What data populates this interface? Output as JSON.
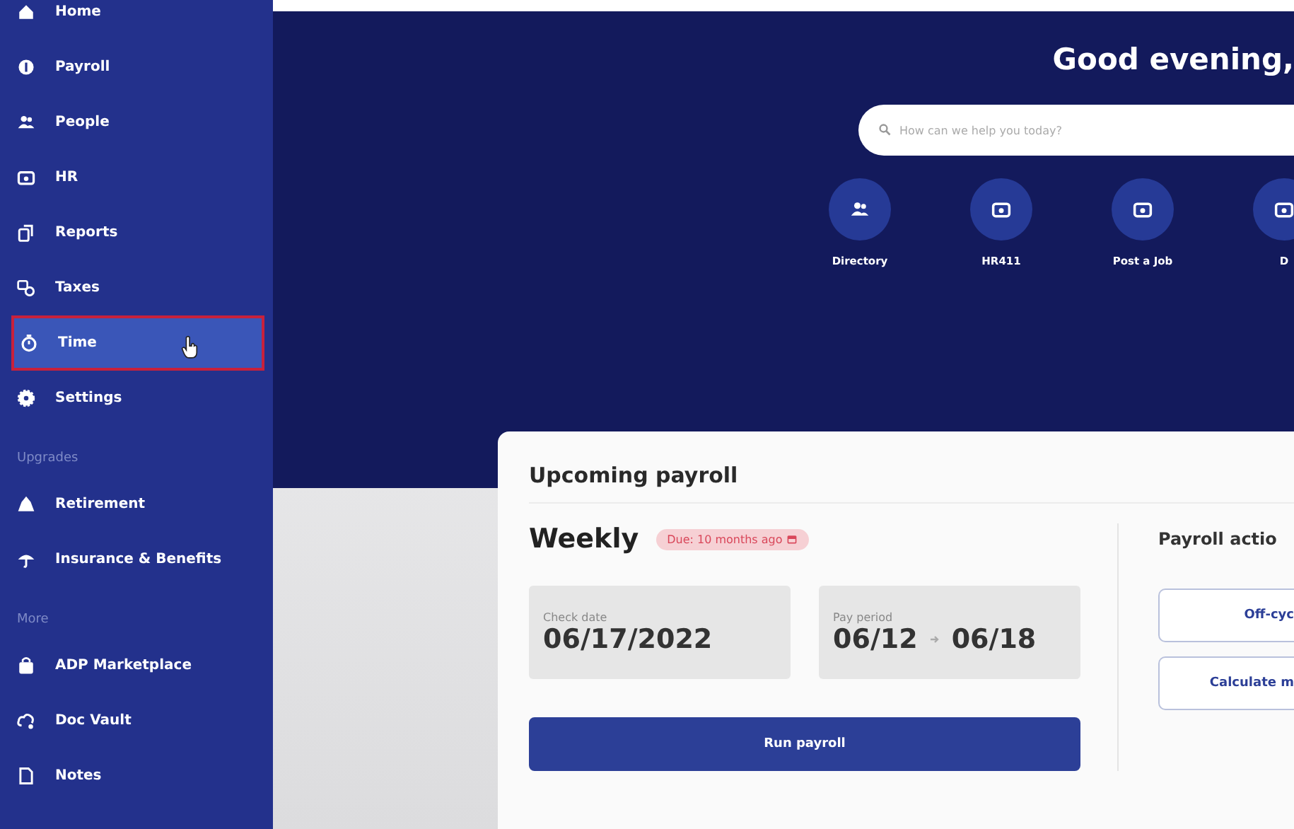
{
  "sidebar": {
    "sections": [
      {
        "items": [
          {
            "label": "Home",
            "selected": false
          },
          {
            "label": "Payroll",
            "selected": false
          },
          {
            "label": "People",
            "selected": false
          },
          {
            "label": "HR",
            "selected": false
          },
          {
            "label": "Reports",
            "selected": false
          },
          {
            "label": "Taxes",
            "selected": false
          },
          {
            "label": "Time",
            "selected": true
          },
          {
            "label": "Settings",
            "selected": false
          }
        ]
      },
      {
        "heading": "Upgrades",
        "items": [
          {
            "label": "Retirement",
            "selected": false
          },
          {
            "label": "Insurance & Benefits",
            "selected": false
          }
        ]
      },
      {
        "heading": "More",
        "items": [
          {
            "label": "ADP Marketplace",
            "selected": false
          },
          {
            "label": "Doc Vault",
            "selected": false
          },
          {
            "label": "Notes",
            "selected": false
          }
        ]
      }
    ]
  },
  "greeting": "Good evening,",
  "search": {
    "placeholder": "How can we help you today?"
  },
  "quick_actions": [
    {
      "label": "Directory"
    },
    {
      "label": "HR411"
    },
    {
      "label": "Post a Job"
    },
    {
      "label": "D"
    }
  ],
  "payroll_card": {
    "title": "Upcoming payroll",
    "schedule": "Weekly",
    "due_badge": "Due: 10 months ago",
    "check_date": {
      "label": "Check date",
      "value": "06/17/2022"
    },
    "pay_period": {
      "label": "Pay period",
      "start": "06/12",
      "end": "06/18"
    },
    "run_button": "Run payroll",
    "actions_title": "Payroll actio",
    "actions": [
      "Off-cyc",
      "Calculate m"
    ]
  }
}
